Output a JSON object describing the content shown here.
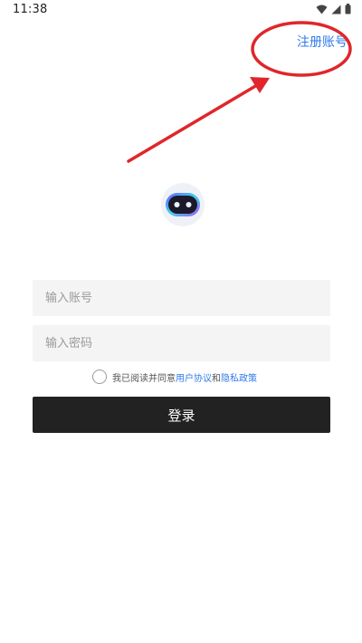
{
  "status_bar": {
    "time": "11:38",
    "icons": [
      "wifi-icon",
      "signal-icon",
      "battery-icon"
    ]
  },
  "header": {
    "register_label": "注册账号"
  },
  "form": {
    "account_placeholder": "输入账号",
    "password_placeholder": "输入密码",
    "agreement": {
      "prefix": "我已阅读并同意",
      "user_agreement": "用户协议",
      "conjunction": "和",
      "privacy_policy": "隐私政策",
      "checked": false
    },
    "login_label": "登录"
  },
  "colors": {
    "accent": "#2f7be8",
    "button_bg": "#222222",
    "field_bg": "#f4f4f4",
    "annotation": "#e0262b"
  }
}
